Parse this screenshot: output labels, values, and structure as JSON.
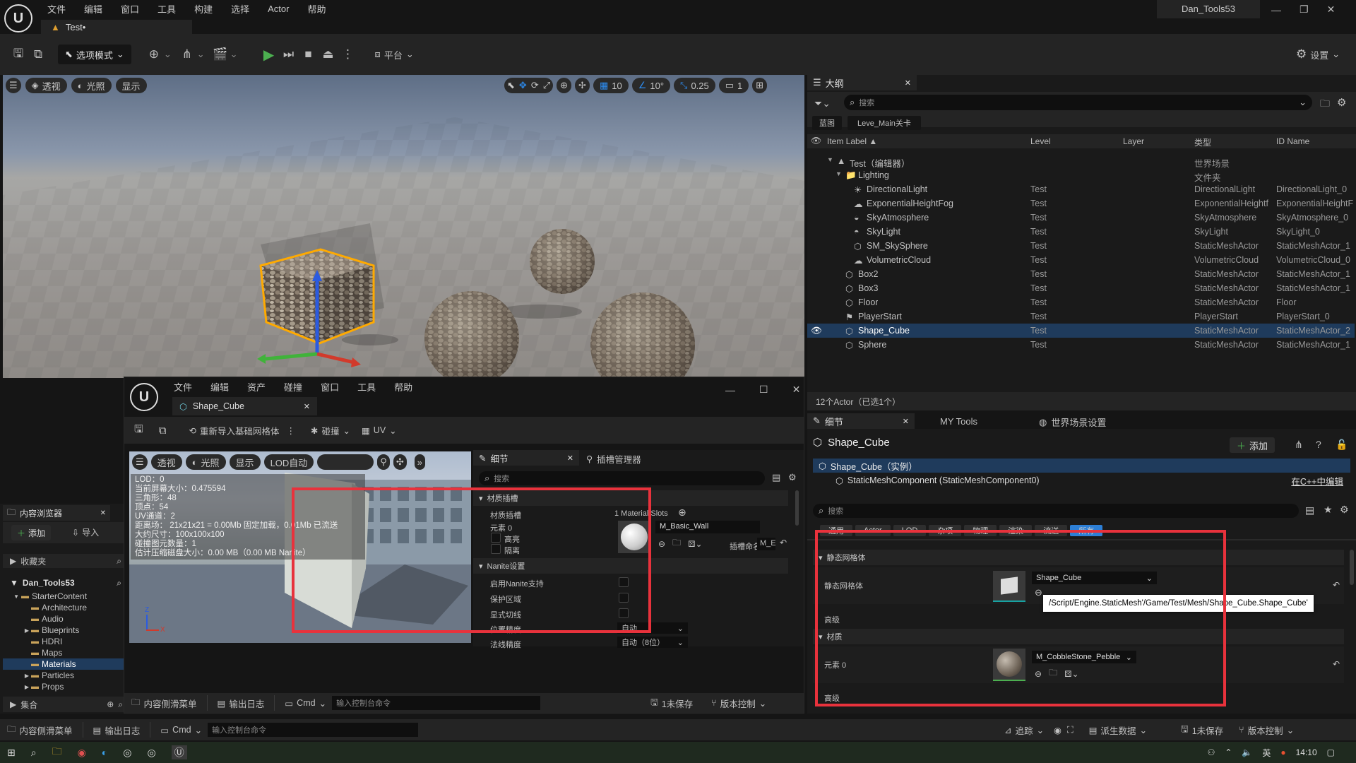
{
  "app": {
    "project_name": "Dan_Tools53",
    "menu": [
      "文件",
      "编辑",
      "窗口",
      "工具",
      "构建",
      "选择",
      "Actor",
      "帮助"
    ],
    "level_tab": "Test•"
  },
  "toolbar": {
    "mode_label": "选项模式",
    "platform_label": "平台",
    "settings_label": "设置"
  },
  "viewport": {
    "perspective": "透视",
    "lit": "光照",
    "show": "显示",
    "grid_snap": "10",
    "rot_snap": "10°",
    "scale_snap": "0.25",
    "camera_speed": "1"
  },
  "outliner": {
    "tab": "大纲",
    "search_placeholder": "搜索",
    "chips": [
      "蓝图",
      "Leve_Main关卡"
    ],
    "headers": {
      "label": "Item Label ▲",
      "level": "Level",
      "layer": "Layer",
      "type": "类型",
      "id": "ID Name"
    },
    "rows": [
      {
        "indent": 1,
        "icon": "▲",
        "label": "Test（编辑器）",
        "level": "",
        "type": "世界场景",
        "id": "",
        "expander": "▼"
      },
      {
        "indent": 2,
        "icon": "📁",
        "label": "Lighting",
        "level": "",
        "type": "文件夹",
        "id": "",
        "expander": "▼"
      },
      {
        "indent": 3,
        "icon": "☀",
        "label": "DirectionalLight",
        "level": "Test",
        "type": "DirectionalLight",
        "id": "DirectionalLight_0",
        "expander": ""
      },
      {
        "indent": 3,
        "icon": "☁",
        "label": "ExponentialHeightFog",
        "level": "Test",
        "type": "ExponentialHeightf",
        "id": "ExponentialHeightF",
        "expander": ""
      },
      {
        "indent": 3,
        "icon": "◒",
        "label": "SkyAtmosphere",
        "level": "Test",
        "type": "SkyAtmosphere",
        "id": "SkyAtmosphere_0",
        "expander": ""
      },
      {
        "indent": 3,
        "icon": "◓",
        "label": "SkyLight",
        "level": "Test",
        "type": "SkyLight",
        "id": "SkyLight_0",
        "expander": ""
      },
      {
        "indent": 3,
        "icon": "⬡",
        "label": "SM_SkySphere",
        "level": "Test",
        "type": "StaticMeshActor",
        "id": "StaticMeshActor_1",
        "expander": ""
      },
      {
        "indent": 3,
        "icon": "☁",
        "label": "VolumetricCloud",
        "level": "Test",
        "type": "VolumetricCloud",
        "id": "VolumetricCloud_0",
        "expander": ""
      },
      {
        "indent": 2,
        "icon": "⬡",
        "label": "Box2",
        "level": "Test",
        "type": "StaticMeshActor",
        "id": "StaticMeshActor_1",
        "expander": ""
      },
      {
        "indent": 2,
        "icon": "⬡",
        "label": "Box3",
        "level": "Test",
        "type": "StaticMeshActor",
        "id": "StaticMeshActor_1",
        "expander": ""
      },
      {
        "indent": 2,
        "icon": "⬡",
        "label": "Floor",
        "level": "Test",
        "type": "StaticMeshActor",
        "id": "Floor",
        "expander": ""
      },
      {
        "indent": 2,
        "icon": "⚑",
        "label": "PlayerStart",
        "level": "Test",
        "type": "PlayerStart",
        "id": "PlayerStart_0",
        "expander": ""
      },
      {
        "indent": 2,
        "icon": "⬡",
        "label": "Shape_Cube",
        "level": "Test",
        "type": "StaticMeshActor",
        "id": "StaticMeshActor_2",
        "expander": "",
        "selected": true
      },
      {
        "indent": 2,
        "icon": "⬡",
        "label": "Sphere",
        "level": "Test",
        "type": "StaticMeshActor",
        "id": "StaticMeshActor_1",
        "expander": ""
      }
    ],
    "footer": "12个Actor（已选1个）"
  },
  "details": {
    "tabs": [
      "细节",
      "MY Tools",
      "世界场景设置"
    ],
    "actor_name": "Shape_Cube",
    "add_label": "添加",
    "instance_label": "Shape_Cube（实例）",
    "component_label": "StaticMeshComponent (StaticMeshComponent0)",
    "cpp_link": "在C++中编辑",
    "search_placeholder": "搜索",
    "filter_tabs": [
      "通用",
      "Actor",
      "LOD",
      "杂项",
      "物理",
      "渲染",
      "流送",
      "所有"
    ],
    "section_static_mesh": "静态网格体",
    "static_mesh_label": "静态网格体",
    "static_mesh_value": "Shape_Cube",
    "tooltip": "/Script/Engine.StaticMesh'/Game/Test/Mesh/Shape_Cube.Shape_Cube'",
    "advanced1": "高级",
    "section_materials": "材质",
    "element0_label": "元素 0",
    "material_value": "M_CobbleStone_Pebble",
    "advanced2": "高级"
  },
  "content_browser": {
    "tab": "内容浏览器",
    "add_label": "添加",
    "import_label": "导入",
    "favorites": "收藏夹",
    "project": "Dan_Tools53",
    "tree": [
      {
        "label": "StarterContent",
        "indent": 1,
        "expander": "▼"
      },
      {
        "label": "Architecture",
        "indent": 2,
        "expander": ""
      },
      {
        "label": "Audio",
        "indent": 2,
        "expander": ""
      },
      {
        "label": "Blueprints",
        "indent": 2,
        "expander": "▶"
      },
      {
        "label": "HDRI",
        "indent": 2,
        "expander": ""
      },
      {
        "label": "Maps",
        "indent": 2,
        "expander": ""
      },
      {
        "label": "Materials",
        "indent": 2,
        "expander": "",
        "selected": true
      },
      {
        "label": "Particles",
        "indent": 2,
        "expander": "▶"
      },
      {
        "label": "Props",
        "indent": 2,
        "expander": "▶"
      }
    ],
    "collections": "集合"
  },
  "mesh_editor": {
    "menu": [
      "文件",
      "编辑",
      "资产",
      "碰撞",
      "窗口",
      "工具",
      "帮助"
    ],
    "tab": "Shape_Cube",
    "reimport_label": "重新导入基础网格体",
    "collision_label": "碰撞",
    "uv_label": "UV",
    "vp_perspective": "透视",
    "vp_lit": "光照",
    "vp_show": "显示",
    "vp_lod": "LOD自动",
    "stats": [
      "LOD：0",
      "当前屏幕大小：0.475594",
      "三角形：48",
      "顶点：54",
      "UV通道：2",
      "距离场：  21x21x21 = 0.00Mb 固定加载，0.01Mb 已流送",
      "大约尺寸：100x100x100",
      "碰撞图元数量：1",
      "估计压缩磁盘大小：0.00 MB（0.00 MB Nanite）"
    ],
    "details_tab": "细节",
    "sockets_tab": "插槽管理器",
    "search_placeholder": "搜索",
    "section_slots": "材质插槽",
    "slots_label": "材质插槽",
    "slots_value": "1 Material Slots",
    "element0": "元素 0",
    "highlight": "高亮",
    "isolate": "隔离",
    "material_name": "M_Basic_Wall",
    "slot_name_label": "插槽命名",
    "slot_name_value": "M_E",
    "section_nanite": "Nanite设置",
    "nanite_enable": "启用Nanite支持",
    "preserve_area": "保护区域",
    "explicit_tangents": "显式切线",
    "position_precision": "位置精度",
    "position_value": "自动",
    "normal_precision": "法线精度",
    "normal_value": "自动（8位）",
    "bottom_drawer": "内容侧滑菜单",
    "output_log": "输出日志",
    "cmd": "Cmd",
    "console_placeholder": "输入控制台命令",
    "unsaved": "1未保存",
    "source_control": "版本控制"
  },
  "statusbar": {
    "drawer": "内容侧滑菜单",
    "output_log": "输出日志",
    "cmd": "Cmd",
    "console_placeholder": "输入控制台命令",
    "trace": "追踪",
    "derived_data": "派生数据",
    "unsaved": "1未保存",
    "source_control": "版本控制"
  },
  "taskbar": {
    "time": "14:10"
  }
}
